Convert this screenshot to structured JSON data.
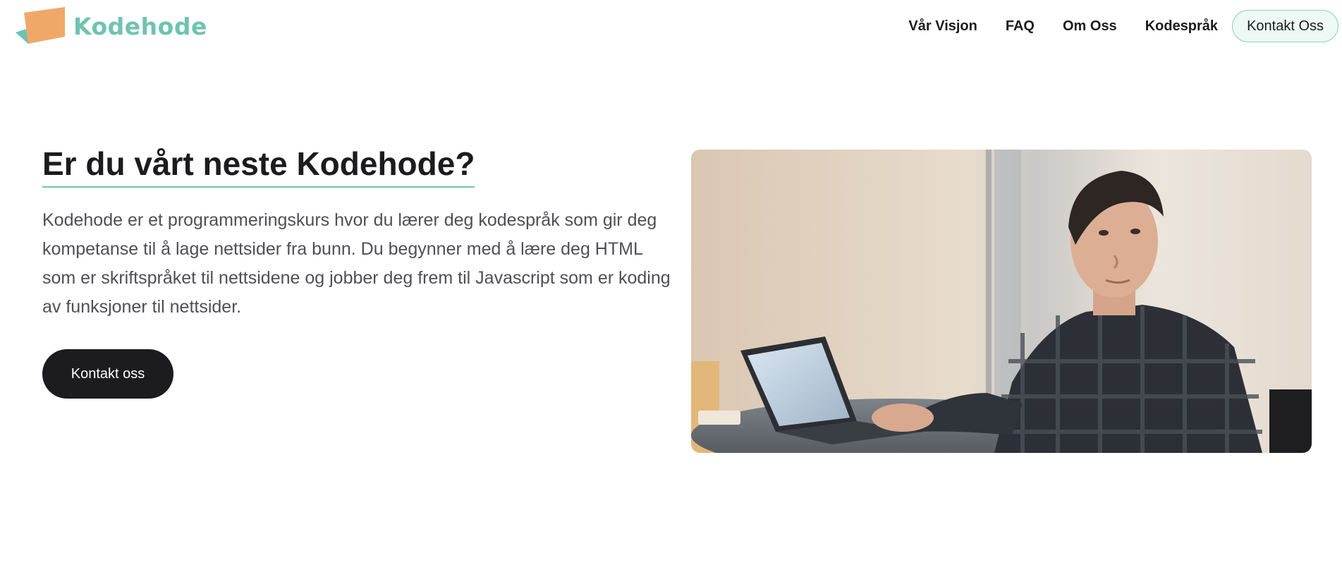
{
  "brand": {
    "name": "Kodehode",
    "accent_color": "#6fc3b0",
    "logo_color_front": "#f0a868",
    "logo_color_back": "#6fc3b0"
  },
  "nav": {
    "items": [
      {
        "label": "Vår Visjon"
      },
      {
        "label": "FAQ"
      },
      {
        "label": "Om Oss"
      },
      {
        "label": "Kodespråk"
      }
    ],
    "cta_label": "Kontakt Oss"
  },
  "hero": {
    "title": "Er du vårt neste Kodehode?",
    "body": "Kodehode er et programmeringskurs hvor du lærer deg kodespråk som gir deg kompetanse til å lage nettsider fra bunn. Du begynner med å lære deg HTML som er skriftspråket til nettsidene og jobber deg frem til Javascript som er koding av funksjoner til nettsider.",
    "button_label": "Kontakt oss"
  }
}
